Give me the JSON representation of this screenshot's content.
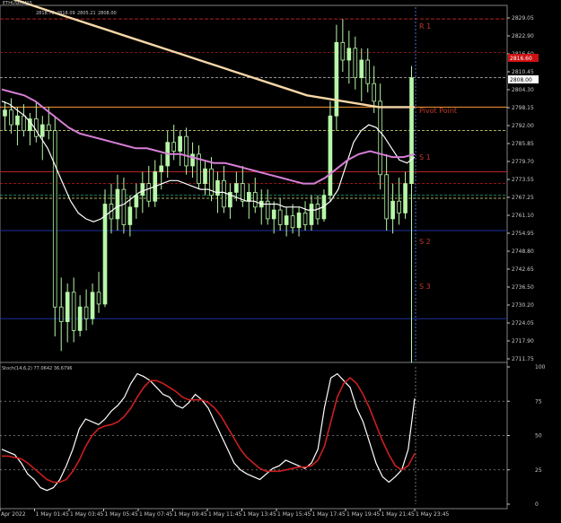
{
  "window": {
    "title": "ETHUSD,M15",
    "ohlc": [
      "2818.70",
      "2818.09",
      "2805.21",
      "2808.00"
    ],
    "indicator_label": "Stoch(14,6,2) 77.0642 36.6796"
  },
  "colors": {
    "background": "#000000",
    "candle": "#b7f7a8",
    "ema_fast": "#ffffff",
    "sma_mid": "#d67ed6",
    "sma_slow": "#f6d7a7",
    "pivot": "#ff9933",
    "resistance": "#b22222",
    "support": "#1f2f9e",
    "stoch_main": "#ffffff",
    "stoch_signal": "#cc1f1f"
  },
  "levels": {
    "r1": "R 1",
    "pivot": "Pivot Point",
    "s1": "S 1",
    "s2": "S 2",
    "s3": "S 3"
  },
  "price_axis": {
    "ticks": [
      "2829.05",
      "2822.90",
      "2816.60",
      "2810.45",
      "2804.30",
      "2798.15",
      "2792.00",
      "2785.85",
      "2779.70",
      "2773.55",
      "2767.25",
      "2761.10",
      "2754.95",
      "2748.80",
      "2742.65",
      "2736.50",
      "2730.20",
      "2724.05",
      "2717.90",
      "2711.75"
    ],
    "current_price": "2808.00",
    "red_marker": "2816.60"
  },
  "stoch_axis": {
    "ticks": [
      "100",
      "75",
      "50",
      "25",
      "0"
    ]
  },
  "time_axis": {
    "labels": [
      "Apr 2022",
      "1 May 01:45",
      "1 May 03:45",
      "1 May 05:45",
      "1 May 07:45",
      "1 May 09:45",
      "1 May 11:45",
      "1 May 13:45",
      "1 May 15:45",
      "1 May 17:45",
      "1 May 19:45",
      "1 May 21:45",
      "1 May 23:45"
    ]
  },
  "chart_data": [
    {
      "type": "candlestick",
      "symbol": "ETHUSD",
      "timeframe": "M15",
      "ylim": [
        2711.75,
        2832
      ],
      "candles": [
        {
          "o": 2795,
          "h": 2800,
          "l": 2790,
          "c": 2797
        },
        {
          "o": 2797,
          "h": 2801,
          "l": 2789,
          "c": 2792
        },
        {
          "o": 2792,
          "h": 2798,
          "l": 2785,
          "c": 2795
        },
        {
          "o": 2795,
          "h": 2799,
          "l": 2788,
          "c": 2790
        },
        {
          "o": 2790,
          "h": 2796,
          "l": 2785,
          "c": 2794
        },
        {
          "o": 2794,
          "h": 2800,
          "l": 2786,
          "c": 2788
        },
        {
          "o": 2788,
          "h": 2795,
          "l": 2780,
          "c": 2792
        },
        {
          "o": 2792,
          "h": 2798,
          "l": 2787,
          "c": 2790
        },
        {
          "o": 2790,
          "h": 2795,
          "l": 2720,
          "c": 2730
        },
        {
          "o": 2730,
          "h": 2740,
          "l": 2715,
          "c": 2725
        },
        {
          "o": 2725,
          "h": 2738,
          "l": 2718,
          "c": 2735
        },
        {
          "o": 2735,
          "h": 2740,
          "l": 2718,
          "c": 2722
        },
        {
          "o": 2722,
          "h": 2734,
          "l": 2720,
          "c": 2730
        },
        {
          "o": 2730,
          "h": 2736,
          "l": 2722,
          "c": 2726
        },
        {
          "o": 2726,
          "h": 2738,
          "l": 2724,
          "c": 2735
        },
        {
          "o": 2735,
          "h": 2742,
          "l": 2728,
          "c": 2731
        },
        {
          "o": 2731,
          "h": 2770,
          "l": 2730,
          "c": 2765
        },
        {
          "o": 2765,
          "h": 2772,
          "l": 2755,
          "c": 2760
        },
        {
          "o": 2760,
          "h": 2775,
          "l": 2756,
          "c": 2770
        },
        {
          "o": 2770,
          "h": 2774,
          "l": 2755,
          "c": 2758
        },
        {
          "o": 2758,
          "h": 2768,
          "l": 2754,
          "c": 2764
        },
        {
          "o": 2764,
          "h": 2772,
          "l": 2760,
          "c": 2768
        },
        {
          "o": 2768,
          "h": 2776,
          "l": 2762,
          "c": 2772
        },
        {
          "o": 2772,
          "h": 2778,
          "l": 2764,
          "c": 2766
        },
        {
          "o": 2766,
          "h": 2780,
          "l": 2764,
          "c": 2776
        },
        {
          "o": 2776,
          "h": 2782,
          "l": 2770,
          "c": 2778
        },
        {
          "o": 2778,
          "h": 2790,
          "l": 2774,
          "c": 2786
        },
        {
          "o": 2786,
          "h": 2792,
          "l": 2780,
          "c": 2783
        },
        {
          "o": 2783,
          "h": 2790,
          "l": 2778,
          "c": 2788
        },
        {
          "o": 2788,
          "h": 2791,
          "l": 2775,
          "c": 2778
        },
        {
          "o": 2778,
          "h": 2786,
          "l": 2774,
          "c": 2782
        },
        {
          "o": 2782,
          "h": 2785,
          "l": 2770,
          "c": 2772
        },
        {
          "o": 2772,
          "h": 2780,
          "l": 2768,
          "c": 2777
        },
        {
          "o": 2777,
          "h": 2781,
          "l": 2766,
          "c": 2768
        },
        {
          "o": 2768,
          "h": 2776,
          "l": 2762,
          "c": 2773
        },
        {
          "o": 2773,
          "h": 2778,
          "l": 2762,
          "c": 2764
        },
        {
          "o": 2764,
          "h": 2772,
          "l": 2760,
          "c": 2769
        },
        {
          "o": 2769,
          "h": 2776,
          "l": 2766,
          "c": 2772
        },
        {
          "o": 2772,
          "h": 2778,
          "l": 2764,
          "c": 2766
        },
        {
          "o": 2766,
          "h": 2772,
          "l": 2760,
          "c": 2769
        },
        {
          "o": 2769,
          "h": 2774,
          "l": 2762,
          "c": 2764
        },
        {
          "o": 2764,
          "h": 2770,
          "l": 2758,
          "c": 2766
        },
        {
          "o": 2766,
          "h": 2770,
          "l": 2758,
          "c": 2760
        },
        {
          "o": 2760,
          "h": 2766,
          "l": 2755,
          "c": 2763
        },
        {
          "o": 2763,
          "h": 2767,
          "l": 2756,
          "c": 2758
        },
        {
          "o": 2758,
          "h": 2764,
          "l": 2754,
          "c": 2761
        },
        {
          "o": 2761,
          "h": 2765,
          "l": 2755,
          "c": 2757
        },
        {
          "o": 2757,
          "h": 2764,
          "l": 2754,
          "c": 2762
        },
        {
          "o": 2762,
          "h": 2766,
          "l": 2756,
          "c": 2758
        },
        {
          "o": 2758,
          "h": 2768,
          "l": 2756,
          "c": 2765
        },
        {
          "o": 2765,
          "h": 2768,
          "l": 2758,
          "c": 2760
        },
        {
          "o": 2760,
          "h": 2770,
          "l": 2759,
          "c": 2768
        },
        {
          "o": 2768,
          "h": 2800,
          "l": 2766,
          "c": 2795
        },
        {
          "o": 2795,
          "h": 2826,
          "l": 2790,
          "c": 2820
        },
        {
          "o": 2820,
          "h": 2828,
          "l": 2810,
          "c": 2814
        },
        {
          "o": 2814,
          "h": 2824,
          "l": 2806,
          "c": 2818
        },
        {
          "o": 2818,
          "h": 2822,
          "l": 2804,
          "c": 2808
        },
        {
          "o": 2808,
          "h": 2818,
          "l": 2800,
          "c": 2814
        },
        {
          "o": 2814,
          "h": 2818,
          "l": 2803,
          "c": 2806
        },
        {
          "o": 2806,
          "h": 2812,
          "l": 2796,
          "c": 2800
        },
        {
          "o": 2800,
          "h": 2806,
          "l": 2770,
          "c": 2775
        },
        {
          "o": 2775,
          "h": 2782,
          "l": 2756,
          "c": 2760
        },
        {
          "o": 2760,
          "h": 2772,
          "l": 2755,
          "c": 2766
        },
        {
          "o": 2766,
          "h": 2774,
          "l": 2758,
          "c": 2762
        },
        {
          "o": 2762,
          "h": 2776,
          "l": 2760,
          "c": 2772
        },
        {
          "o": 2772,
          "h": 2812,
          "l": 2711,
          "c": 2808
        }
      ],
      "series": [
        {
          "name": "",
          "values": [
            2800,
            2799,
            2797,
            2795,
            2792,
            2788,
            2784,
            2778,
            2772,
            2766,
            2762,
            2760,
            2759,
            2760,
            2762,
            2764,
            2765,
            2767,
            2769,
            2770,
            2771,
            2772,
            2773,
            2773,
            2772,
            2771,
            2770,
            2770,
            2769,
            2769,
            2768,
            2767,
            2766,
            2766,
            2765,
            2765,
            2765,
            2764,
            2764,
            2764,
            2763,
            2763,
            2764,
            2766,
            2770,
            2778,
            2786,
            2790,
            2792,
            2791,
            2788,
            2784,
            2780,
            2779,
            2781
          ]
        },
        {
          "name": "",
          "values": [
            2804,
            2803,
            2802,
            2800,
            2797,
            2794,
            2791,
            2789,
            2788,
            2787,
            2786,
            2785,
            2784,
            2784,
            2783,
            2782,
            2782,
            2781,
            2780,
            2779,
            2779,
            2778,
            2777,
            2776,
            2775,
            2774,
            2773,
            2772,
            2772,
            2774,
            2777,
            2780,
            2782,
            2783,
            2782,
            2781,
            2781,
            2782
          ]
        },
        {
          "name": "",
          "values": [
            2836,
            2834,
            2832,
            2830,
            2828,
            2826,
            2824,
            2822,
            2820,
            2818,
            2816,
            2814,
            2812,
            2810,
            2808,
            2806,
            2804,
            2802,
            2801,
            2800,
            2799,
            2798,
            2798,
            2798
          ]
        }
      ],
      "levels": [
        {
          "label": "R 1",
          "value": 2828
        },
        {
          "label": "Pivot Point",
          "value": 2798
        },
        {
          "label": "S 1",
          "value": 2776
        },
        {
          "label": "S 2",
          "value": 2756
        },
        {
          "label": "S 3",
          "value": 2726
        }
      ]
    },
    {
      "type": "line",
      "name": "Stoch(14,6,2)",
      "ylim": [
        0,
        100
      ],
      "levels": [
        75,
        50,
        25
      ],
      "series": [
        {
          "name": "",
          "values": [
            40,
            38,
            36,
            30,
            22,
            18,
            12,
            10,
            12,
            18,
            28,
            40,
            55,
            62,
            60,
            58,
            62,
            68,
            72,
            78,
            88,
            95,
            93,
            90,
            85,
            80,
            78,
            72,
            70,
            74,
            80,
            76,
            70,
            60,
            50,
            40,
            30,
            25,
            22,
            20,
            18,
            22,
            26,
            28,
            32,
            30,
            28,
            26,
            30,
            40,
            70,
            92,
            95,
            90,
            85,
            70,
            60,
            45,
            30,
            20,
            16,
            20,
            25,
            40,
            77
          ]
        },
        {
          "name": "",
          "values": [
            35,
            35,
            34,
            33,
            30,
            26,
            22,
            18,
            16,
            16,
            18,
            24,
            32,
            42,
            50,
            55,
            57,
            58,
            60,
            64,
            70,
            78,
            85,
            90,
            90,
            88,
            85,
            82,
            78,
            76,
            76,
            76,
            74,
            70,
            64,
            56,
            48,
            40,
            34,
            30,
            26,
            24,
            24,
            24,
            25,
            26,
            27,
            27,
            28,
            32,
            42,
            60,
            78,
            88,
            92,
            88,
            80,
            70,
            58,
            46,
            36,
            28,
            25,
            28,
            37
          ]
        }
      ]
    }
  ]
}
